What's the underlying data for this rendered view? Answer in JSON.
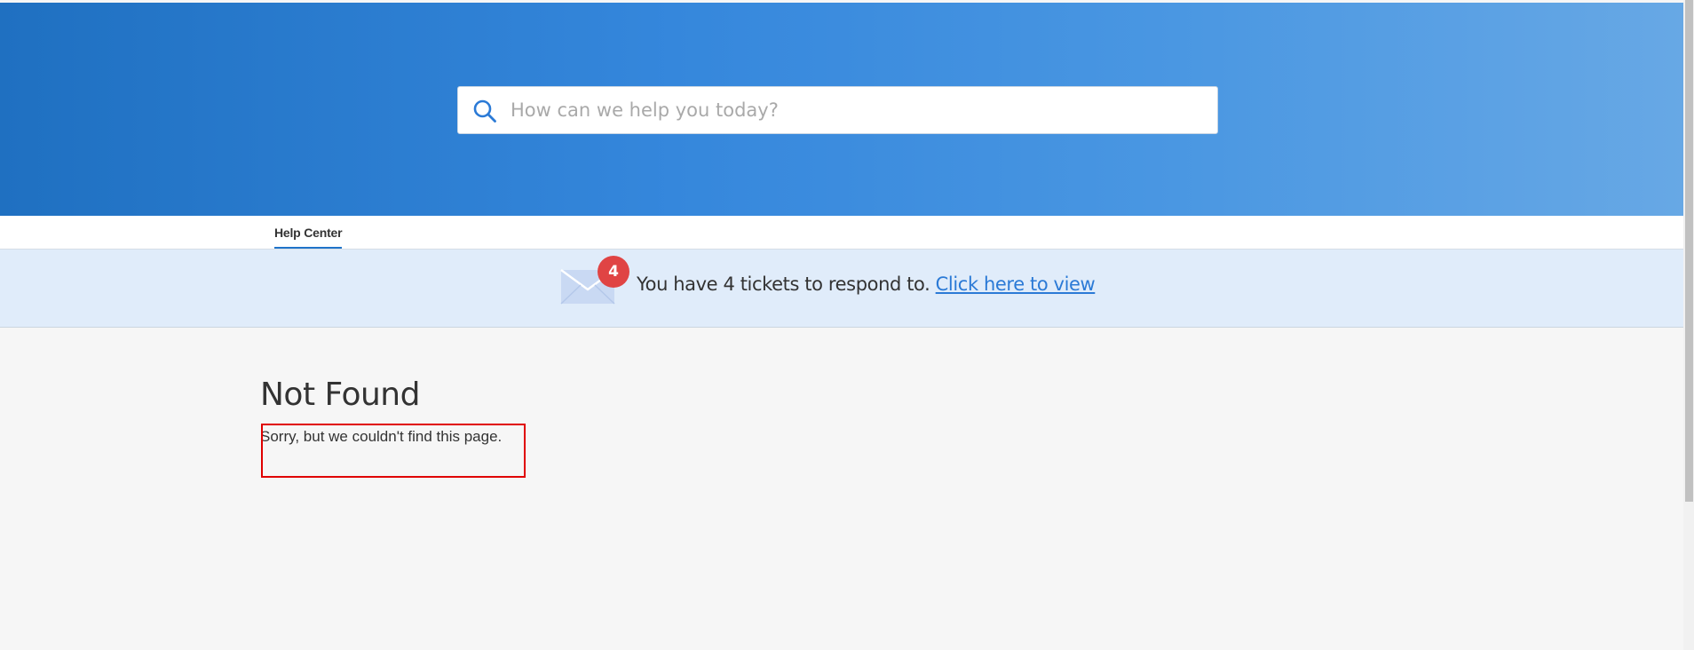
{
  "search": {
    "placeholder": "How can we help you today?"
  },
  "nav": {
    "tabs": [
      {
        "label": "Help Center",
        "active": true
      }
    ]
  },
  "notification": {
    "badge_count": "4",
    "message": "You have 4 tickets to respond to.",
    "link_label": "Click here to view"
  },
  "main": {
    "title": "Not Found",
    "message": "Sorry, but we couldn't find this page."
  },
  "colors": {
    "hero_gradient_start": "#1f70c1",
    "hero_gradient_end": "#67a8e5",
    "accent": "#2b7ad6",
    "badge": "#e04444",
    "banner_background": "#e0ecfa",
    "highlight_border": "#e00000"
  },
  "icons": {
    "search": "search-icon",
    "mail": "envelope-icon"
  }
}
